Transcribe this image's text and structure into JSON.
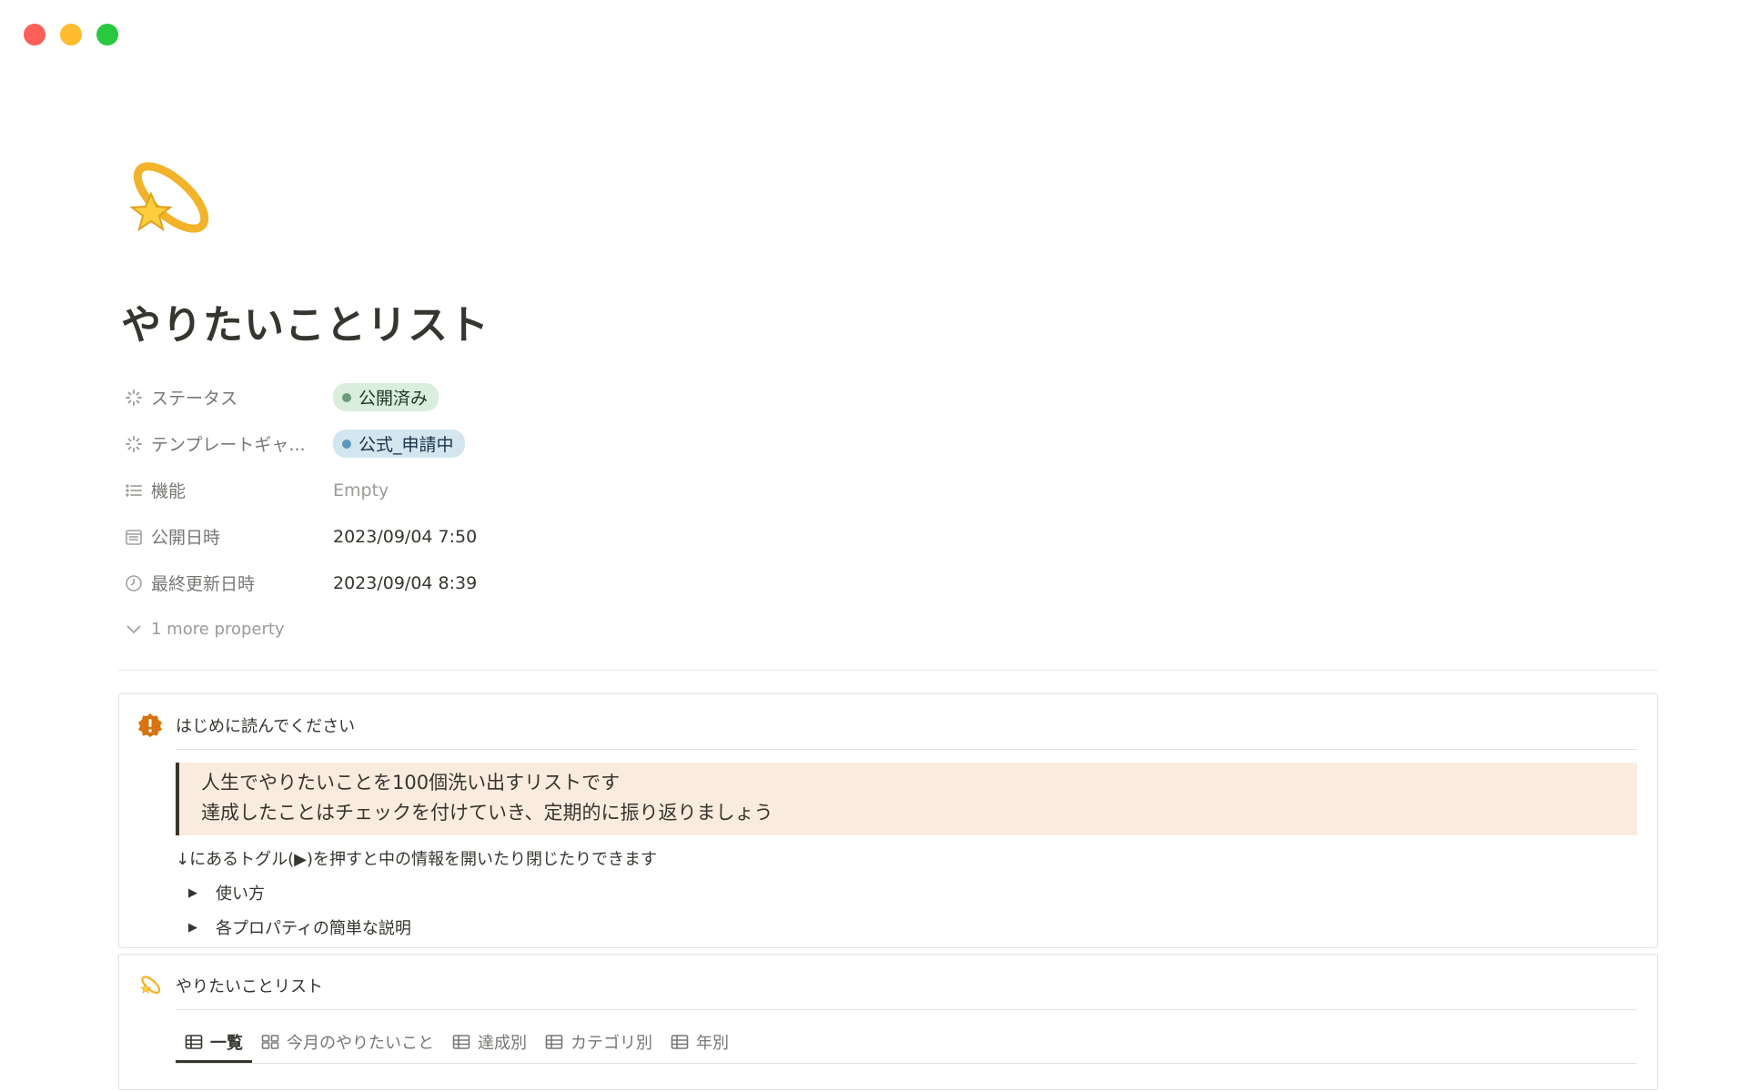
{
  "window": {
    "controls": [
      "close",
      "minimize",
      "zoom"
    ]
  },
  "page": {
    "icon": "shooting-star-icon",
    "title": "やりたいことリスト"
  },
  "properties": [
    {
      "icon": "status-icon",
      "label": "ステータス",
      "type": "tag",
      "value": "公開済み",
      "tag_color": "#dbeddb"
    },
    {
      "icon": "status-icon",
      "label": "テンプレートギャ...",
      "type": "tag",
      "value": "公式_申請中",
      "tag_color": "#d3e5ef"
    },
    {
      "icon": "list-icon",
      "label": "機能",
      "type": "empty",
      "value": "Empty"
    },
    {
      "icon": "calendar-icon",
      "label": "公開日時",
      "type": "text",
      "value": "2023/09/04 7:50"
    },
    {
      "icon": "clock-icon",
      "label": "最終更新日時",
      "type": "text",
      "value": "2023/09/04 8:39"
    }
  ],
  "more_property": "1 more property",
  "callout": {
    "icon": "exclamation-badge-icon",
    "heading": "はじめに読んでください",
    "quote_lines": [
      "人生でやりたいことを100個洗い出すリストです",
      "達成したことはチェックを付けていき、定期的に振り返りましょう"
    ],
    "note": "↓にあるトグル(▶)を押すと中の情報を開いたり閉じたりできます",
    "toggles": [
      "使い方",
      "各プロパティの簡単な説明"
    ]
  },
  "database": {
    "icon": "shooting-star-icon",
    "title": "やりたいことリスト",
    "tabs": [
      {
        "label": "一覧",
        "icon": "table-icon",
        "active": true
      },
      {
        "label": "今月のやりたいこと",
        "icon": "gallery-icon",
        "active": false
      },
      {
        "label": "達成別",
        "icon": "table-icon",
        "active": false
      },
      {
        "label": "カテゴリ別",
        "icon": "table-icon",
        "active": false
      },
      {
        "label": "年別",
        "icon": "table-icon",
        "active": false
      }
    ]
  },
  "colors": {
    "quote_bg": "#f9ebde",
    "callout_icon": "#d9730d"
  }
}
